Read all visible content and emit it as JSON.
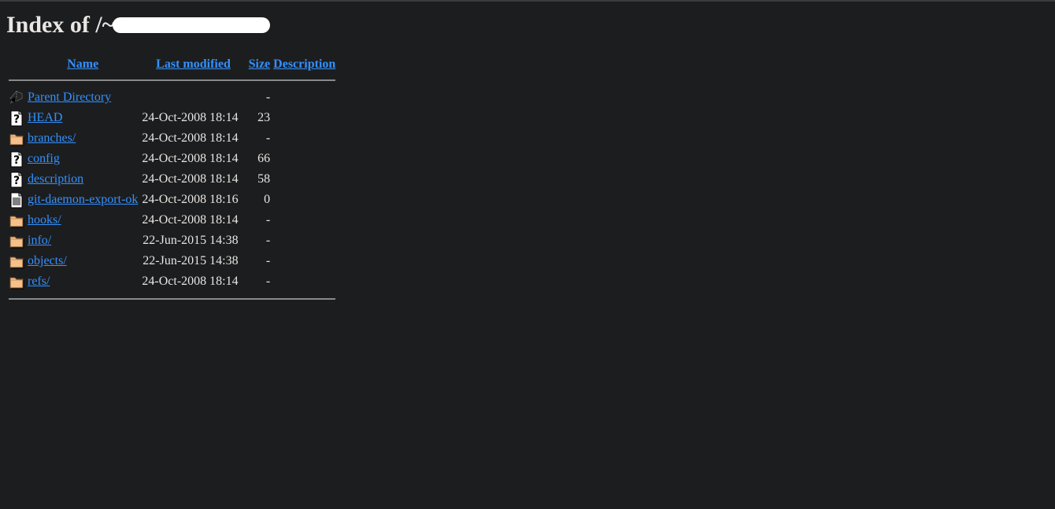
{
  "page": {
    "title_prefix": "Index of /~",
    "title_redacted": true
  },
  "table": {
    "headers": {
      "name": "Name",
      "last_modified": "Last modified",
      "size": "Size",
      "description": "Description"
    },
    "rows": [
      {
        "icon": "back-icon",
        "name": "Parent Directory",
        "modified": "",
        "size": "-",
        "description": ""
      },
      {
        "icon": "unknown-file-icon",
        "name": "HEAD",
        "modified": "24-Oct-2008 18:14",
        "size": "23",
        "description": ""
      },
      {
        "icon": "folder-icon",
        "name": "branches/",
        "modified": "24-Oct-2008 18:14",
        "size": "-",
        "description": ""
      },
      {
        "icon": "unknown-file-icon",
        "name": "config",
        "modified": "24-Oct-2008 18:14",
        "size": "66",
        "description": ""
      },
      {
        "icon": "unknown-file-icon",
        "name": "description",
        "modified": "24-Oct-2008 18:14",
        "size": "58",
        "description": ""
      },
      {
        "icon": "text-file-icon",
        "name": "git-daemon-export-ok",
        "modified": "24-Oct-2008 18:16",
        "size": "0",
        "description": ""
      },
      {
        "icon": "folder-icon",
        "name": "hooks/",
        "modified": "24-Oct-2008 18:14",
        "size": "-",
        "description": ""
      },
      {
        "icon": "folder-icon",
        "name": "info/",
        "modified": "22-Jun-2015 14:38",
        "size": "-",
        "description": ""
      },
      {
        "icon": "folder-icon",
        "name": "objects/",
        "modified": "22-Jun-2015 14:38",
        "size": "-",
        "description": ""
      },
      {
        "icon": "folder-icon",
        "name": "refs/",
        "modified": "24-Oct-2008 18:14",
        "size": "-",
        "description": ""
      }
    ]
  },
  "colors": {
    "background": "#1c1d1f",
    "text": "#e8e6e3",
    "link": "#3391ff",
    "folder": "#f5c08a"
  }
}
